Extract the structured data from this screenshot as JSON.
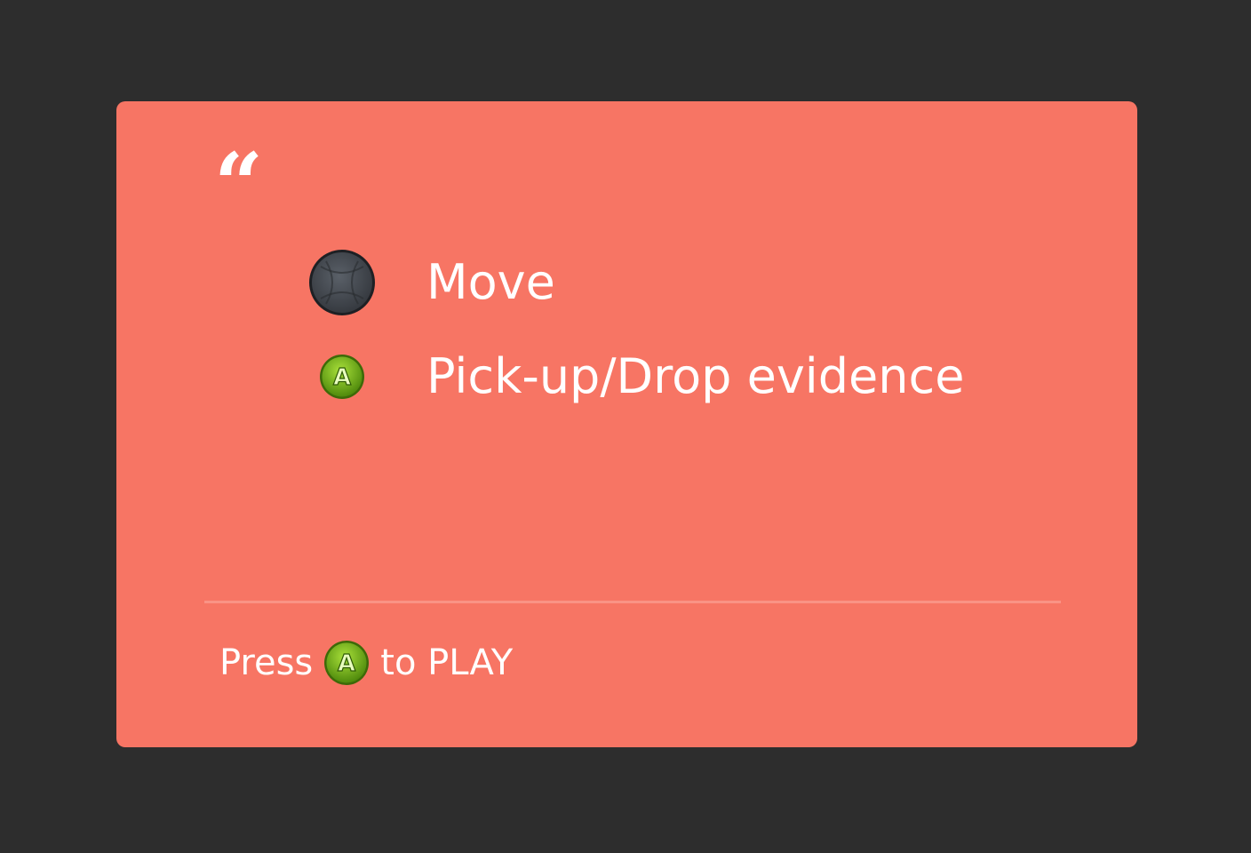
{
  "card": {
    "quote_glyph": "“",
    "controls": [
      {
        "icon": "left-stick-icon",
        "label": "Move"
      },
      {
        "icon": "a-button-icon",
        "label": "Pick-up/Drop evidence"
      }
    ]
  },
  "footer": {
    "press_label": "Press",
    "button_icon": "a-button-icon",
    "play_label": "to PLAY"
  },
  "colors": {
    "background": "#2d2d2d",
    "card": "#f77564",
    "divider": "#fa9385",
    "text": "#ffffff",
    "a_button": "#7cb518"
  }
}
